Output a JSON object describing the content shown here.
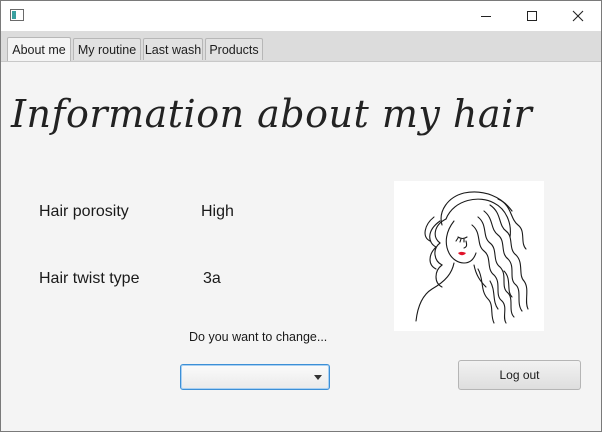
{
  "window": {
    "minimize_icon": "minimize-icon",
    "maximize_icon": "maximize-icon",
    "close_icon": "close-icon"
  },
  "tabs": [
    {
      "label": "About me",
      "active": true
    },
    {
      "label": "My routine",
      "active": false
    },
    {
      "label": "Last wash",
      "active": false
    },
    {
      "label": "Products",
      "active": false
    }
  ],
  "main": {
    "heading": "Information about my hair",
    "rows": [
      {
        "label": "Hair porosity",
        "value": "High"
      },
      {
        "label": "Hair twist type",
        "value": "3a"
      }
    ],
    "change_prompt": "Do you want to change...",
    "change_select": {
      "selected": ""
    },
    "logout_label": "Log out",
    "image": "woman-with-wavy-hair-illustration"
  },
  "colors": {
    "background": "#f4f4f4",
    "focus_border": "#3c8fd6",
    "lips": "#e0132a"
  }
}
